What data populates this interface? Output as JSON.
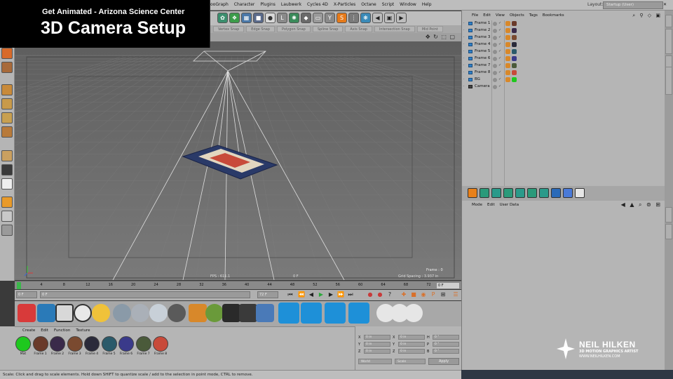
{
  "overlay": {
    "subtitle": "Get Animated - Arizona Science Center",
    "title": "3D Camera Setup"
  },
  "menubar": {
    "menus": [
      "ooGraph",
      "Character",
      "Plugins",
      "Laubwerk",
      "Cycles 4D",
      "X-Particles",
      "Octane",
      "Script",
      "Window",
      "Help"
    ],
    "layout_label": "Layout:",
    "layout_value": "Startup (User)"
  },
  "snap": {
    "items": [
      "Vertex Snap",
      "Edge Snap",
      "Polygon Snap",
      "Spline Snap",
      "Axis Snap",
      "Intersection Snap",
      "Mid Point"
    ]
  },
  "viewport": {
    "fps": "FPS : 611.1",
    "frame_center": "0 F",
    "grid_spacing": "Grid Spacing : 3.937 in",
    "frame_label": "Frame : 0"
  },
  "timeline": {
    "ticks": [
      "0",
      "4",
      "8",
      "12",
      "16",
      "20",
      "24",
      "28",
      "32",
      "36",
      "40",
      "44",
      "48",
      "52",
      "56",
      "60",
      "64",
      "68",
      "72"
    ],
    "end_value": "0 F"
  },
  "transport": {
    "start_field": "0 F",
    "current_field": "0 F",
    "end_field": "72 F"
  },
  "material_manager": {
    "menus": [
      "Create",
      "Edit",
      "Function",
      "Texture"
    ],
    "materials": [
      {
        "label": "Mat",
        "color": "#1ec81e"
      },
      {
        "label": "Frame 1",
        "color": "#6a3a2a"
      },
      {
        "label": "Frame 2",
        "color": "#3a2a4a"
      },
      {
        "label": "Frame 3",
        "color": "#7a4a30"
      },
      {
        "label": "Frame 4",
        "color": "#2a2a3a"
      },
      {
        "label": "Frame 5",
        "color": "#2a5a6a"
      },
      {
        "label": "Frame 6",
        "color": "#3a3a8a"
      },
      {
        "label": "Frame 7",
        "color": "#4a5a3a"
      },
      {
        "label": "Frame 8",
        "color": "#c84a3a"
      }
    ]
  },
  "coordinates": {
    "rows": [
      {
        "a": "X",
        "a_val": "0 in",
        "b": "X",
        "b_val": "0 in",
        "c": "H",
        "c_val": "0 °"
      },
      {
        "a": "Y",
        "a_val": "0 in",
        "b": "Y",
        "b_val": "0 in",
        "c": "P",
        "c_val": "0 °"
      },
      {
        "a": "Z",
        "a_val": "0 in",
        "b": "Z",
        "b_val": "0 in",
        "c": "B",
        "c_val": "0 °"
      }
    ],
    "mode_select": "World",
    "size_select": "Scale",
    "apply_label": "Apply"
  },
  "status": {
    "text": "Scale: Click and drag to scale elements. Hold down SHIFT to quantize scale / add to the selection in point mode, CTRL to remove."
  },
  "object_manager": {
    "menus": [
      "File",
      "Edit",
      "View",
      "Objects",
      "Tags",
      "Bookmarks"
    ],
    "objects": [
      {
        "name": "Frame 1",
        "tag_color": "#6a3a2a"
      },
      {
        "name": "Frame 2",
        "tag_color": "#3a2a4a"
      },
      {
        "name": "Frame 3",
        "tag_color": "#7a4a30"
      },
      {
        "name": "Frame 4",
        "tag_color": "#2a2a3a"
      },
      {
        "name": "Frame 5",
        "tag_color": "#2a5a6a"
      },
      {
        "name": "Frame 6",
        "tag_color": "#3a3a8a"
      },
      {
        "name": "Frame 7",
        "tag_color": "#4a5a3a"
      },
      {
        "name": "Frame 8",
        "tag_color": "#c84a3a"
      },
      {
        "name": "BG",
        "tag_color": "#1ec81e"
      },
      {
        "name": "Camera",
        "tag_color": ""
      }
    ]
  },
  "attribute_manager": {
    "menus": [
      "Mode",
      "Edit",
      "User Data"
    ]
  },
  "logo": {
    "name": "NEIL HILKEN",
    "tagline": "3D MOTION GRAPHICS ARTIST",
    "url": "WWW.NEILHILKEN.COM"
  },
  "colors": {
    "accent_green": "#1ec81e",
    "object_blue": "#2f7fc6",
    "viewport_gray": "#6a6a6a",
    "ui_gray": "#b5b5b5"
  }
}
